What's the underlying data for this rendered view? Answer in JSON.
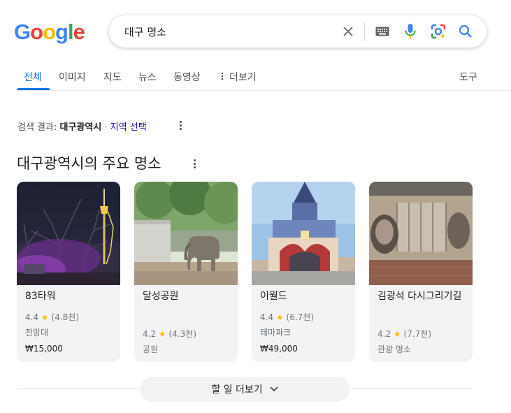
{
  "logo": {
    "letters": [
      "G",
      "o",
      "o",
      "g",
      "l",
      "e"
    ],
    "colors": [
      "#4285F4",
      "#EA4335",
      "#FBBC05",
      "#4285F4",
      "#34A853",
      "#EA4335"
    ]
  },
  "search": {
    "query": "대구 명소",
    "icons": [
      "close-icon",
      "keyboard-icon",
      "mic-icon",
      "lens-icon",
      "search-icon"
    ]
  },
  "tabs": [
    {
      "label": "전체",
      "active": true
    },
    {
      "label": "이미지"
    },
    {
      "label": "지도"
    },
    {
      "label": "뉴스"
    },
    {
      "label": "동영상"
    },
    {
      "label": "더보기"
    }
  ],
  "tools_label": "도구",
  "location": {
    "prefix": "검색 결과:",
    "place": "대구광역시",
    "separator": "·",
    "link": "지역 선택"
  },
  "section_title": "대구광역시의 주요 명소",
  "cards": [
    {
      "name": "83타워",
      "rating": "4.4",
      "reviews": "(4.8천)",
      "category": "전망대",
      "price": "₩15,000"
    },
    {
      "name": "달성공원",
      "rating": "4.2",
      "reviews": "(4.3천)",
      "category": "공원",
      "price": ""
    },
    {
      "name": "이월드",
      "rating": "4.4",
      "reviews": "(6.7천)",
      "category": "테마파크",
      "price": "₩49,000"
    },
    {
      "name": "김광석 다시그리기길",
      "rating": "4.2",
      "reviews": "(7.7천)",
      "category": "관광 명소",
      "price": ""
    }
  ],
  "more_button": {
    "label": "할 일 더보기"
  },
  "colors": {
    "accent": "#1a73e8",
    "star": "#fbbc04",
    "link": "#1a0dab"
  }
}
